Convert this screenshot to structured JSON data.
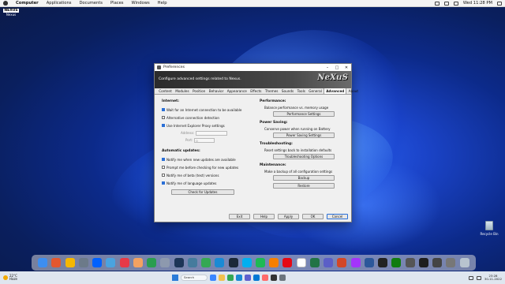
{
  "menubar": {
    "app_name": "Computer",
    "items": [
      "Applications",
      "Documents",
      "Places",
      "Windows",
      "Help"
    ],
    "clock": "Wed 11:28 PM"
  },
  "desktop": {
    "widget_label": "Nexus",
    "widget_logo": "NEXUS",
    "recycle_label": "Recycle Bin"
  },
  "dialog": {
    "title": "Preferences",
    "banner_text": "Configure advanced settings related to Nexus.",
    "banner_logo": "NeXuS",
    "tabs": [
      "Content",
      "Modules",
      "Position",
      "Behavior",
      "Appearance",
      "Effects",
      "Themes",
      "Sounds",
      "Tools",
      "General",
      "Advanced",
      "About"
    ],
    "active_tab": "Advanced",
    "internet": {
      "title": "Internet:",
      "wait_label": "Wait for an Internet connection to be available",
      "wait_checked": true,
      "alt_detect_label": "Alternative connection detection",
      "alt_detect_checked": false,
      "proxy_label": "Use Internet Explorer Proxy settings",
      "proxy_checked": true,
      "address_label": "Address:",
      "address_value": "",
      "port_label": "Port:",
      "port_value": "0"
    },
    "updates": {
      "title": "Automatic updates:",
      "notify_new_label": "Notify me when new updates are available",
      "notify_new_checked": true,
      "prompt_label": "Prompt me before checking for new updates",
      "prompt_checked": false,
      "beta_label": "Notify me of beta (test) versions",
      "beta_checked": false,
      "lang_label": "Notify me of language updates",
      "lang_checked": true,
      "check_button": "Check for Updates"
    },
    "performance": {
      "title": "Performance:",
      "desc": "Balance performance vs. memory usage",
      "button": "Performance Settings"
    },
    "power": {
      "title": "Power Saving:",
      "desc": "Conserve power when running on Battery",
      "button": "Power Saving Settings"
    },
    "troubleshooting": {
      "title": "Troubleshooting:",
      "desc": "Reset settings back to installation defaults",
      "button": "Troubleshooting Options"
    },
    "maintenance": {
      "title": "Maintenance:",
      "desc": "Make a backup of all configuration settings",
      "backup_button": "Backup",
      "restore_button": "Restore"
    },
    "footer": {
      "exit": "Exit",
      "help": "Help",
      "apply": "Apply",
      "ok": "OK",
      "cancel": "Cancel"
    }
  },
  "dock": {
    "icons": [
      {
        "name": "finder-icon",
        "color": "#3d8ef0"
      },
      {
        "name": "launchpad-icon",
        "color": "#e4572e"
      },
      {
        "name": "photos-icon",
        "color": "#f5b700"
      },
      {
        "name": "files-icon",
        "color": "#6c7a89"
      },
      {
        "name": "dropbox-icon",
        "color": "#0061fe"
      },
      {
        "name": "cloud-icon",
        "color": "#4aa3df"
      },
      {
        "name": "vivaldi-icon",
        "color": "#e63946"
      },
      {
        "name": "notes-icon",
        "color": "#f4a261"
      },
      {
        "name": "evernote-icon",
        "color": "#2a9d4f"
      },
      {
        "name": "photos2-icon",
        "color": "#8d99ae"
      },
      {
        "name": "shield-icon",
        "color": "#1d3557"
      },
      {
        "name": "mail-icon",
        "color": "#457b9d"
      },
      {
        "name": "chrome-icon",
        "color": "#34a853"
      },
      {
        "name": "edge-icon",
        "color": "#1a8ad4"
      },
      {
        "name": "steam-icon",
        "color": "#1b2838"
      },
      {
        "name": "skype-icon",
        "color": "#00aff0"
      },
      {
        "name": "spotify-icon",
        "color": "#1db954"
      },
      {
        "name": "vlc-icon",
        "color": "#f77f00"
      },
      {
        "name": "netflix-icon",
        "color": "#e50914"
      },
      {
        "name": "calendar-icon",
        "color": "#ffffff"
      },
      {
        "name": "excel-icon",
        "color": "#217346"
      },
      {
        "name": "teams-icon",
        "color": "#5b5fc7"
      },
      {
        "name": "powerpoint-icon",
        "color": "#d24726"
      },
      {
        "name": "messenger-icon",
        "color": "#a334fa"
      },
      {
        "name": "word-icon",
        "color": "#2b579a"
      },
      {
        "name": "arrow-icon",
        "color": "#222222"
      },
      {
        "name": "xbox-icon",
        "color": "#107c10"
      },
      {
        "name": "settings-icon",
        "color": "#555555"
      },
      {
        "name": "terminal-icon",
        "color": "#1e1e1e"
      },
      {
        "name": "calculator-icon",
        "color": "#444444"
      },
      {
        "name": "app-icon",
        "color": "#777777"
      },
      {
        "name": "trash-icon",
        "color": "#b8c4cf"
      }
    ]
  },
  "taskbar": {
    "temp": "22°C",
    "weather": "Haze",
    "search_label": "Search",
    "time": "23:28",
    "date": "30-11-2022",
    "apps": [
      {
        "name": "widgets-icon",
        "color": "#3a86ff"
      },
      {
        "name": "explorer-icon",
        "color": "#f2c14e"
      },
      {
        "name": "chrome-taskbar-icon",
        "color": "#34a853"
      },
      {
        "name": "edge-taskbar-icon",
        "color": "#1a8ad4"
      },
      {
        "name": "store-icon",
        "color": "#5e60ce"
      },
      {
        "name": "mail-taskbar-icon",
        "color": "#0078d4"
      },
      {
        "name": "photos-taskbar-icon",
        "color": "#ff6b6b"
      },
      {
        "name": "nexus-taskbar-icon",
        "color": "#333333"
      },
      {
        "name": "settings-taskbar-icon",
        "color": "#6c757d"
      }
    ]
  }
}
